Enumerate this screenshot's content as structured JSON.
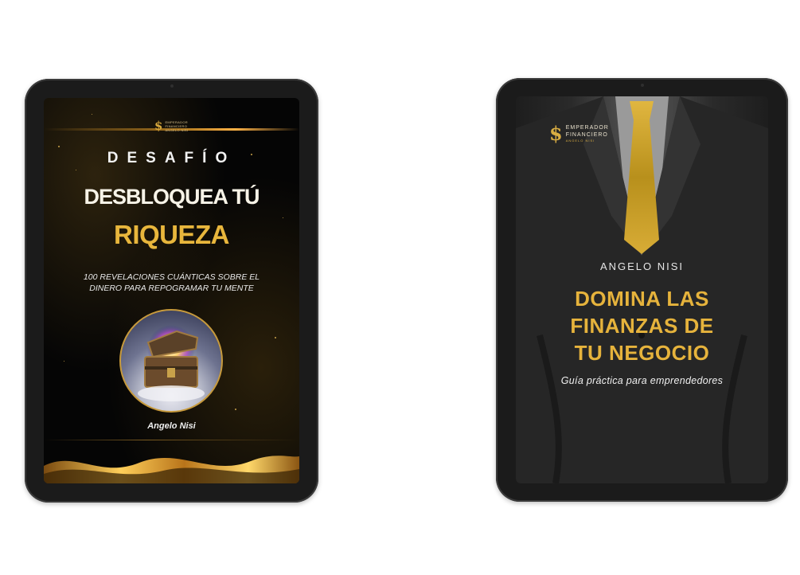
{
  "books": [
    {
      "logo": {
        "mark": "$",
        "line1": "EMPERADOR",
        "line2": "FINANCIERO",
        "line3": "ANGELO NISI"
      },
      "kicker": "DESAFÍO",
      "title_line1": "DESBLOQUEA TÚ",
      "title_line2": "RIQUEZA",
      "subtitle": "100 REVELACIONES CUÁNTICAS SOBRE EL DINERO PARA REPOGRAMAR TU MENTE",
      "author": "Angelo Nisi",
      "image_icon": "treasure-chest-icon"
    },
    {
      "logo": {
        "mark": "$",
        "line1": "EMPERADOR",
        "line2": "FINANCIERO",
        "line3": "ANGELO NISI"
      },
      "author": "ANGELO NISI",
      "title_lines": [
        "DOMINA LAS",
        "FINANZAS DE",
        "TU NEGOCIO"
      ],
      "tagline": "Guía práctica para emprendedores"
    }
  ],
  "colors": {
    "gold": "#e6b33c",
    "tablet_frame": "#1b1b1b",
    "background": "#ffffff"
  }
}
